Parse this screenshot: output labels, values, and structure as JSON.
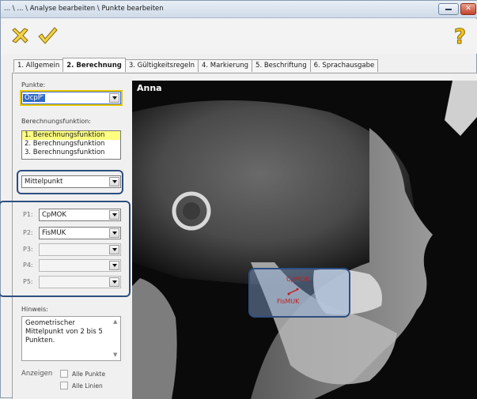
{
  "window": {
    "title": "... \\ ... \\ Analyse bearbeiten \\ Punkte bearbeiten"
  },
  "toolbar": {
    "cancel_icon": "cancel-x-icon",
    "ok_icon": "ok-check-icon",
    "help_icon": "help-question-icon"
  },
  "tabs": [
    {
      "label": "1. Allgemein"
    },
    {
      "label": "2. Berechnung",
      "active": true
    },
    {
      "label": "3. Gültigkeitsregeln"
    },
    {
      "label": "4. Markierung"
    },
    {
      "label": "5. Beschriftung"
    },
    {
      "label": "6. Sprachausgabe"
    }
  ],
  "left": {
    "punkte_label": "Punkte:",
    "punkte_value": "OcpP'",
    "func_label": "Berechnungsfunktion:",
    "functions": [
      "1. Berechnungsfunktion",
      "2. Berechnungsfunktion",
      "3. Berechnungsfunktion"
    ],
    "method_value": "Mittelpunkt",
    "points": [
      {
        "label": "P1:",
        "value": "CpMOK"
      },
      {
        "label": "P2:",
        "value": "FisMUK"
      },
      {
        "label": "P3:",
        "value": ""
      },
      {
        "label": "P4:",
        "value": ""
      },
      {
        "label": "P5:",
        "value": ""
      }
    ],
    "hint_label": "Hinweis:",
    "hint_text": "Geometrischer Mittelpunkt von 2 bis 5 Punkten.",
    "anzeigen_label": "Anzeigen",
    "opt_punkte": "Alle Punkte",
    "opt_linien": "Alle Linien"
  },
  "viewer": {
    "patient_name": "Anna",
    "point1_label": "CpMOK",
    "point2_label": "FisMUK"
  },
  "colors": {
    "highlight": "#2e4f80",
    "point_label": "#c0201c",
    "list_selected": "#ffff80"
  }
}
